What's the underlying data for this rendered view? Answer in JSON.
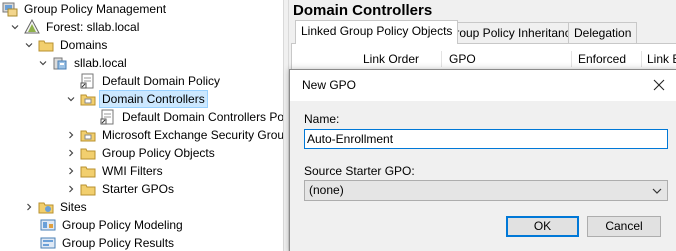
{
  "tree": {
    "items": [
      {
        "label": "Group Policy Management"
      },
      {
        "label": "Forest: sllab.local"
      },
      {
        "label": "Domains"
      },
      {
        "label": "sllab.local"
      },
      {
        "label": "Default Domain Policy"
      },
      {
        "label": "Domain Controllers"
      },
      {
        "label": "Default Domain Controllers Po"
      },
      {
        "label": "Microsoft Exchange Security Group"
      },
      {
        "label": "Group Policy Objects"
      },
      {
        "label": "WMI Filters"
      },
      {
        "label": "Starter GPOs"
      },
      {
        "label": "Sites"
      },
      {
        "label": "Group Policy Modeling"
      },
      {
        "label": "Group Policy Results"
      }
    ]
  },
  "right": {
    "title": "Domain Controllers",
    "tabs": [
      {
        "label": "Linked Group Policy Objects"
      },
      {
        "label": "Group Policy Inheritance"
      },
      {
        "label": "Delegation"
      }
    ],
    "columns": [
      "Link Order",
      "GPO",
      "Enforced",
      "Link E"
    ]
  },
  "dialog": {
    "title": "New GPO",
    "name_label": "Name:",
    "name_value": "Auto-Enrollment",
    "starter_label": "Source Starter GPO:",
    "starter_value": "(none)",
    "ok_label": "OK",
    "cancel_label": "Cancel"
  },
  "colors": {
    "selection": "#cce8ff",
    "focus": "#0078d7",
    "folder": "#e8c36a"
  }
}
